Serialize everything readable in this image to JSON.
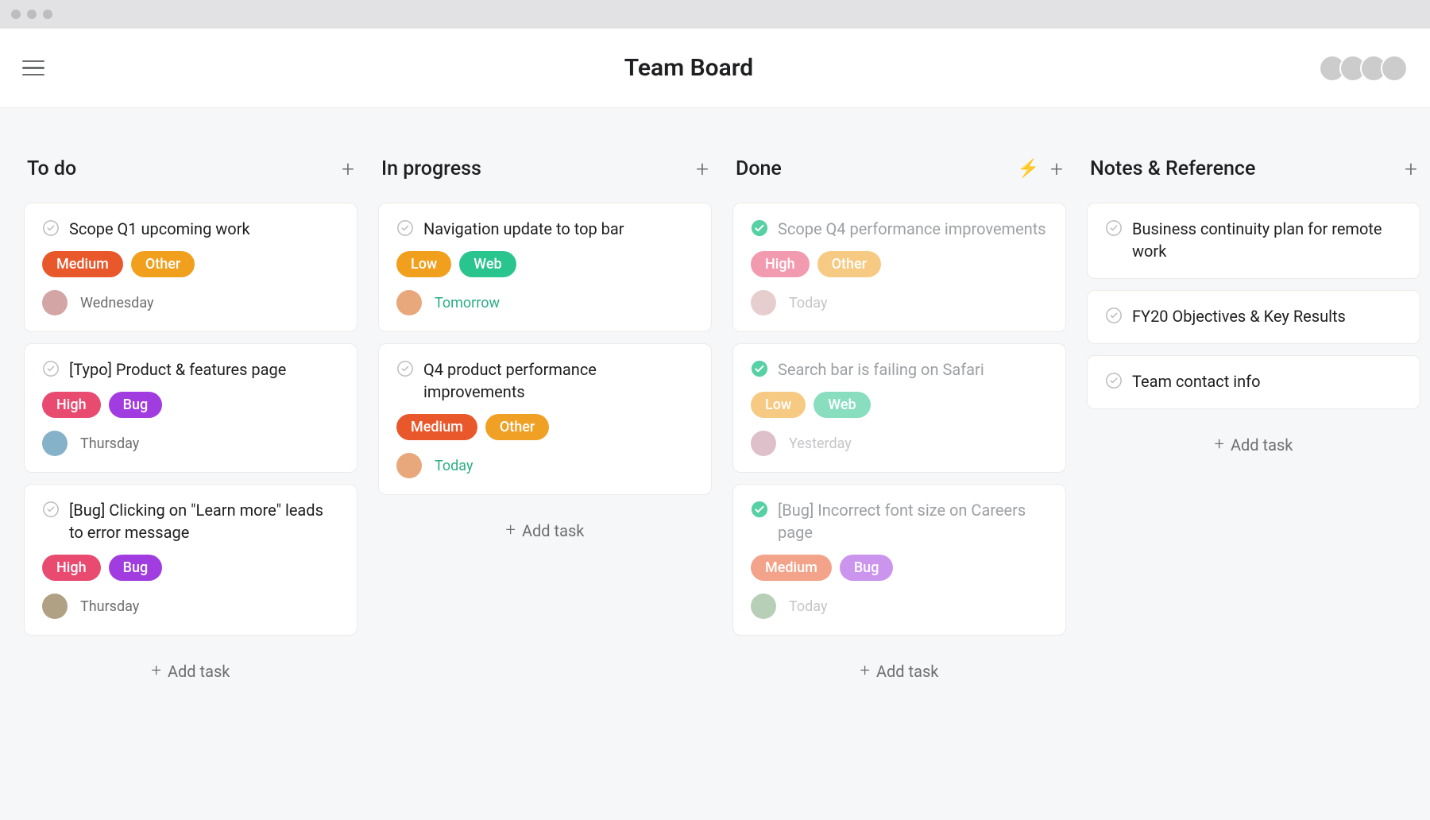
{
  "header": {
    "title": "Team Board",
    "avatar_count": 4
  },
  "labels": {
    "add_task": "Add task"
  },
  "tag_colors": {
    "Medium": "#e8582b",
    "Other": "#f1a01e",
    "High": "#e84a70",
    "Bug": "#a13de0",
    "Low": "#f1a01e",
    "Web": "#2ac48e"
  },
  "columns": [
    {
      "title": "To do",
      "has_bolt": false,
      "cards": [
        {
          "title": "Scope Q1 upcoming work",
          "done": false,
          "tags": [
            {
              "label": "Medium",
              "cls": "t-medium"
            },
            {
              "label": "Other",
              "cls": "t-other"
            }
          ],
          "due": "Wednesday",
          "due_soon": false,
          "assignee": "av-e"
        },
        {
          "title": "[Typo] Product & features page",
          "done": false,
          "tags": [
            {
              "label": "High",
              "cls": "t-high"
            },
            {
              "label": "Bug",
              "cls": "t-bug"
            }
          ],
          "due": "Thursday",
          "due_soon": false,
          "assignee": "av-c"
        },
        {
          "title": "[Bug] Clicking on \"Learn more\" leads to error message",
          "done": false,
          "tags": [
            {
              "label": "High",
              "cls": "t-high"
            },
            {
              "label": "Bug",
              "cls": "t-bug"
            }
          ],
          "due": "Thursday",
          "due_soon": false,
          "assignee": "av-f"
        }
      ]
    },
    {
      "title": "In progress",
      "has_bolt": false,
      "cards": [
        {
          "title": "Navigation update to top bar",
          "done": false,
          "tags": [
            {
              "label": "Low",
              "cls": "t-low"
            },
            {
              "label": "Web",
              "cls": "t-web"
            }
          ],
          "due": "Tomorrow",
          "due_soon": true,
          "assignee": "av-a"
        },
        {
          "title": "Q4 product performance improvements",
          "done": false,
          "tags": [
            {
              "label": "Medium",
              "cls": "t-medium"
            },
            {
              "label": "Other",
              "cls": "t-other-o"
            }
          ],
          "due": "Today",
          "due_soon": true,
          "assignee": "av-a"
        }
      ]
    },
    {
      "title": "Done",
      "has_bolt": true,
      "cards": [
        {
          "title": "Scope Q4 performance improvements",
          "done": true,
          "tags": [
            {
              "label": "High",
              "cls": "t-high"
            },
            {
              "label": "Other",
              "cls": "t-other"
            }
          ],
          "due": "Today",
          "due_soon": false,
          "assignee": "av-e"
        },
        {
          "title": "Search bar is failing on Safari",
          "done": true,
          "tags": [
            {
              "label": "Low",
              "cls": "t-low"
            },
            {
              "label": "Web",
              "cls": "t-web"
            }
          ],
          "due": "Yesterday",
          "due_soon": false,
          "assignee": "av-b"
        },
        {
          "title": "[Bug] Incorrect font size on Careers page",
          "done": true,
          "tags": [
            {
              "label": "Medium",
              "cls": "t-medium"
            },
            {
              "label": "Bug",
              "cls": "t-bug"
            }
          ],
          "due": "Today",
          "due_soon": false,
          "assignee": "av-d"
        }
      ]
    },
    {
      "title": "Notes & Reference",
      "has_bolt": false,
      "cards": [
        {
          "title": "Business continuity plan for remote work",
          "done": false,
          "simple": true
        },
        {
          "title": "FY20 Objectives & Key Results",
          "done": false,
          "simple": true
        },
        {
          "title": "Team contact info",
          "done": false,
          "simple": true
        }
      ]
    }
  ]
}
